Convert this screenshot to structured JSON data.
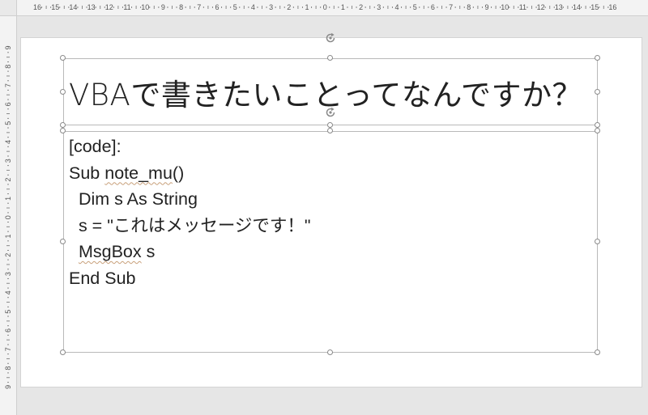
{
  "ruler": {
    "horizontal_labels": [
      "16",
      "15",
      "14",
      "13",
      "12",
      "11",
      "10",
      "9",
      "8",
      "7",
      "6",
      "5",
      "4",
      "3",
      "2",
      "1",
      "0",
      "1",
      "2",
      "3",
      "4",
      "5",
      "6",
      "7",
      "8",
      "9",
      "10",
      "11",
      "12",
      "13",
      "14",
      "15",
      "16"
    ],
    "vertical_labels": [
      "9",
      "8",
      "7",
      "6",
      "5",
      "4",
      "3",
      "2",
      "1",
      "0",
      "1",
      "2",
      "3",
      "4",
      "5",
      "6",
      "7",
      "8",
      "9"
    ]
  },
  "slide": {
    "title": "VBAで書きたいことってなんですか？",
    "code_lines": [
      {
        "parts": [
          {
            "text": "[code]:",
            "squiggle": false
          }
        ]
      },
      {
        "parts": [
          {
            "text": "Sub ",
            "squiggle": false
          },
          {
            "text": "note_mu",
            "squiggle": true
          },
          {
            "text": "()",
            "squiggle": false
          }
        ]
      },
      {
        "parts": [
          {
            "text": "  Dim s As String",
            "squiggle": false
          }
        ]
      },
      {
        "parts": [
          {
            "text": "  s = \"これはメッセージです！\"",
            "squiggle": false
          }
        ]
      },
      {
        "parts": [
          {
            "text": "  ",
            "squiggle": false
          },
          {
            "text": "MsgBox",
            "squiggle": true
          },
          {
            "text": " s",
            "squiggle": false
          }
        ]
      },
      {
        "parts": [
          {
            "text": "End Sub",
            "squiggle": false
          }
        ]
      }
    ]
  },
  "colors": {
    "canvas": "#e6e6e6",
    "slide": "#ffffff",
    "text": "#222222",
    "selection_border": "#b9b9b9",
    "spell_squiggle": "#c8a07a"
  }
}
